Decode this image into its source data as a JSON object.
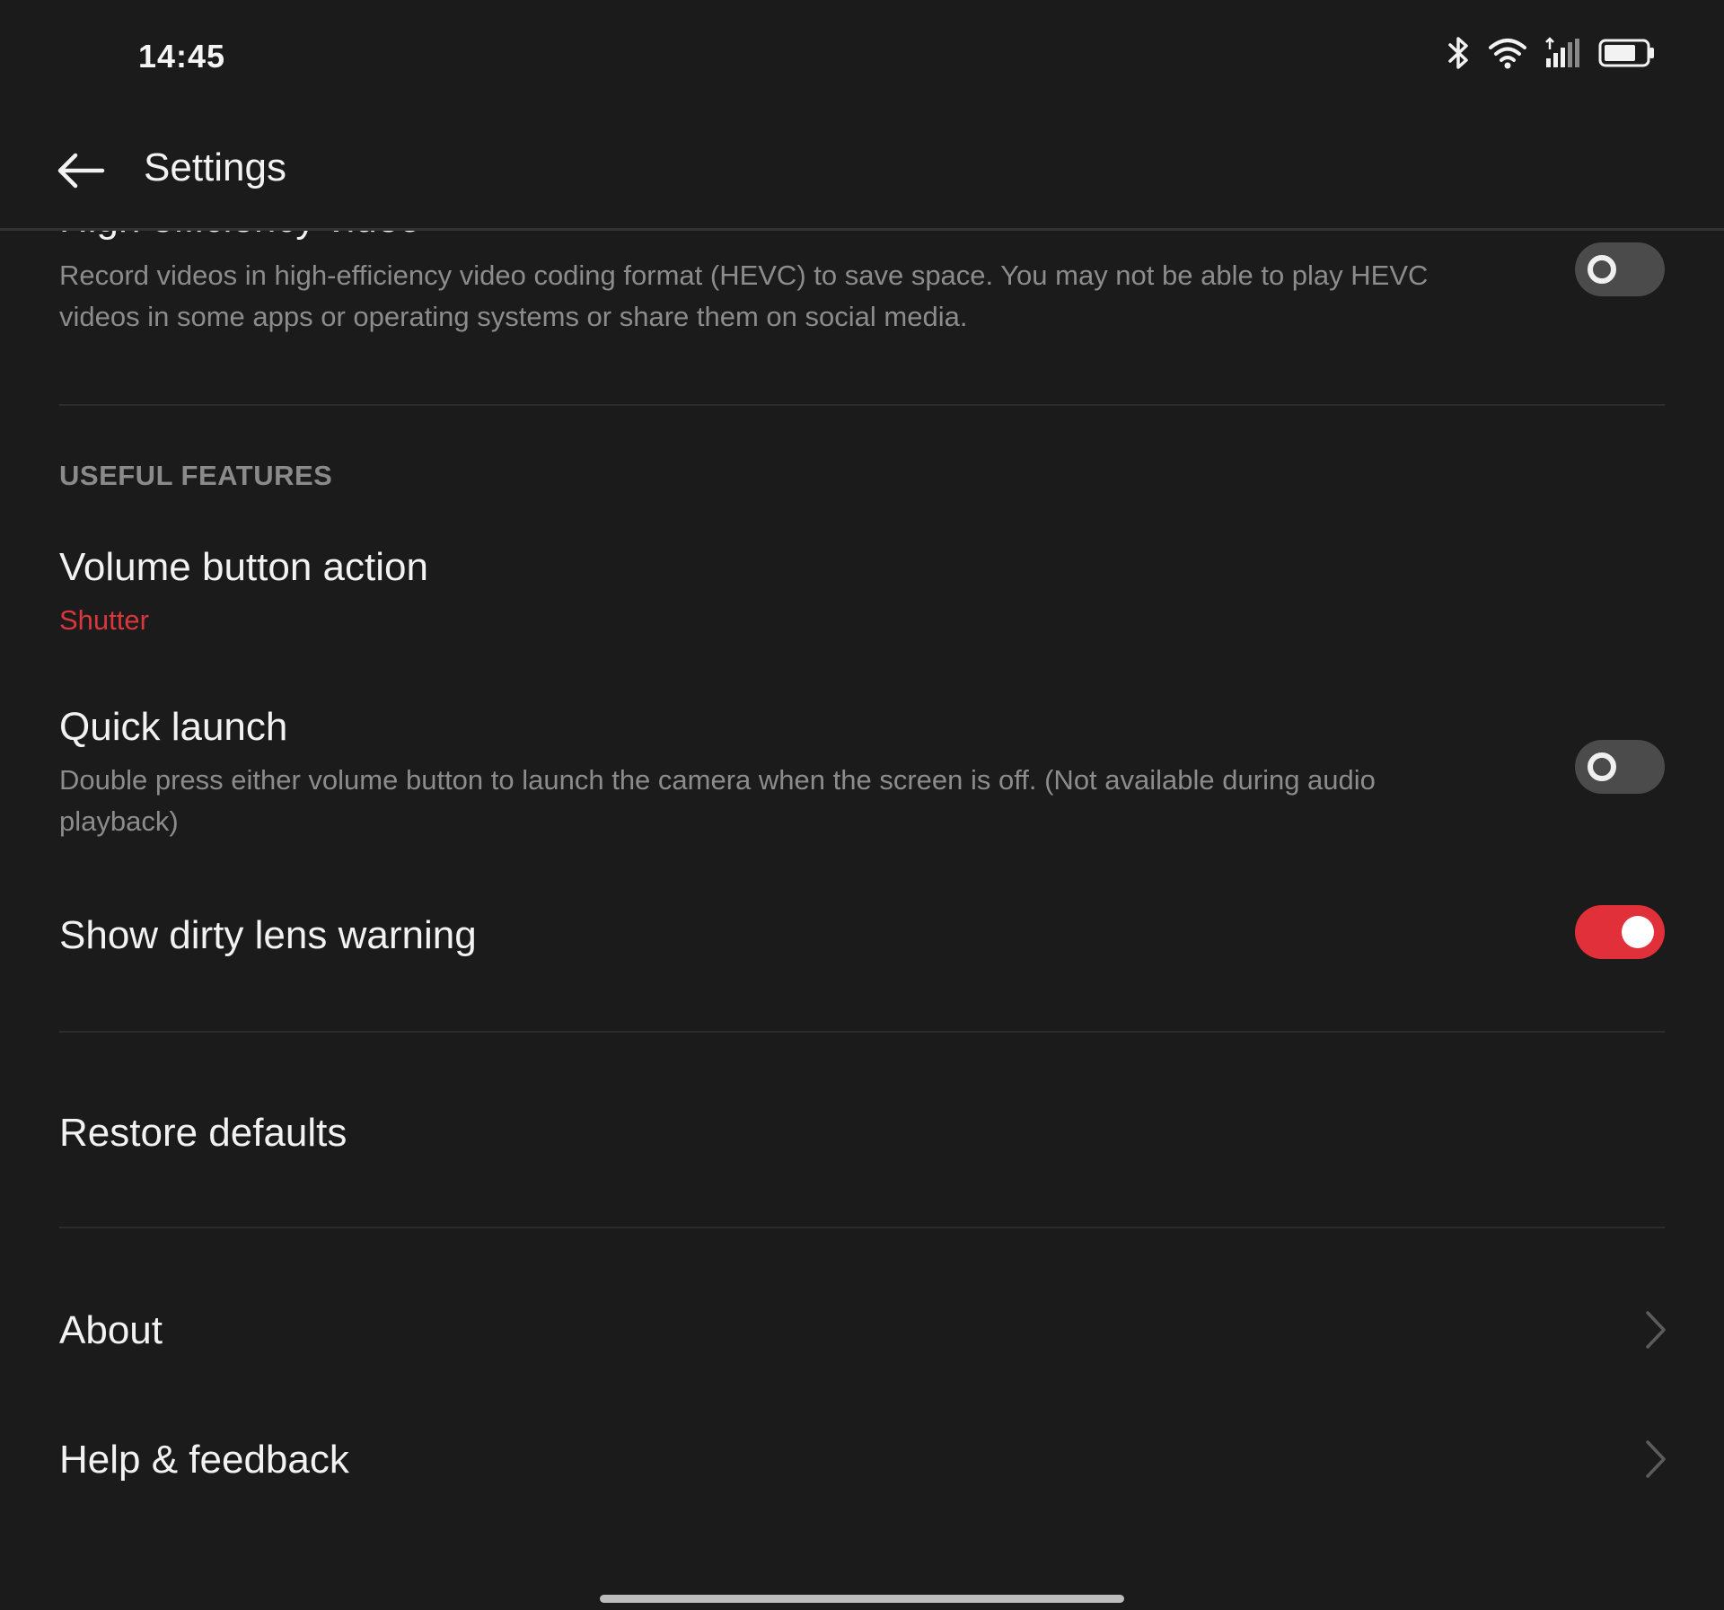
{
  "status_bar": {
    "time": "14:45"
  },
  "app_bar": {
    "title": "Settings"
  },
  "settings": {
    "hevc": {
      "title": "High efficiency video",
      "description": "Record videos in high-efficiency video coding format (HEVC) to save space. You may not be able to play HEVC videos in some apps or operating systems or share them on social media.",
      "enabled": false
    },
    "useful_features_header": "USEFUL FEATURES",
    "volume_button_action": {
      "title": "Volume button action",
      "value": "Shutter"
    },
    "quick_launch": {
      "title": "Quick launch",
      "description": "Double press either volume button to launch the camera when the screen is off. (Not available during audio playback)",
      "enabled": false
    },
    "dirty_lens_warning": {
      "title": "Show dirty lens warning",
      "enabled": true
    },
    "restore_defaults": {
      "title": "Restore defaults"
    },
    "about": {
      "title": "About"
    },
    "help_feedback": {
      "title": "Help & feedback"
    }
  },
  "colors": {
    "background": "#1b1b1b",
    "accent": "#e2303b",
    "text_primary": "#f2f2f2",
    "text_secondary": "#8c8c8c"
  },
  "icons": [
    "bluetooth-icon",
    "wifi-icon",
    "signal-icon",
    "battery-icon",
    "back-arrow-icon",
    "chevron-right-icon"
  ]
}
